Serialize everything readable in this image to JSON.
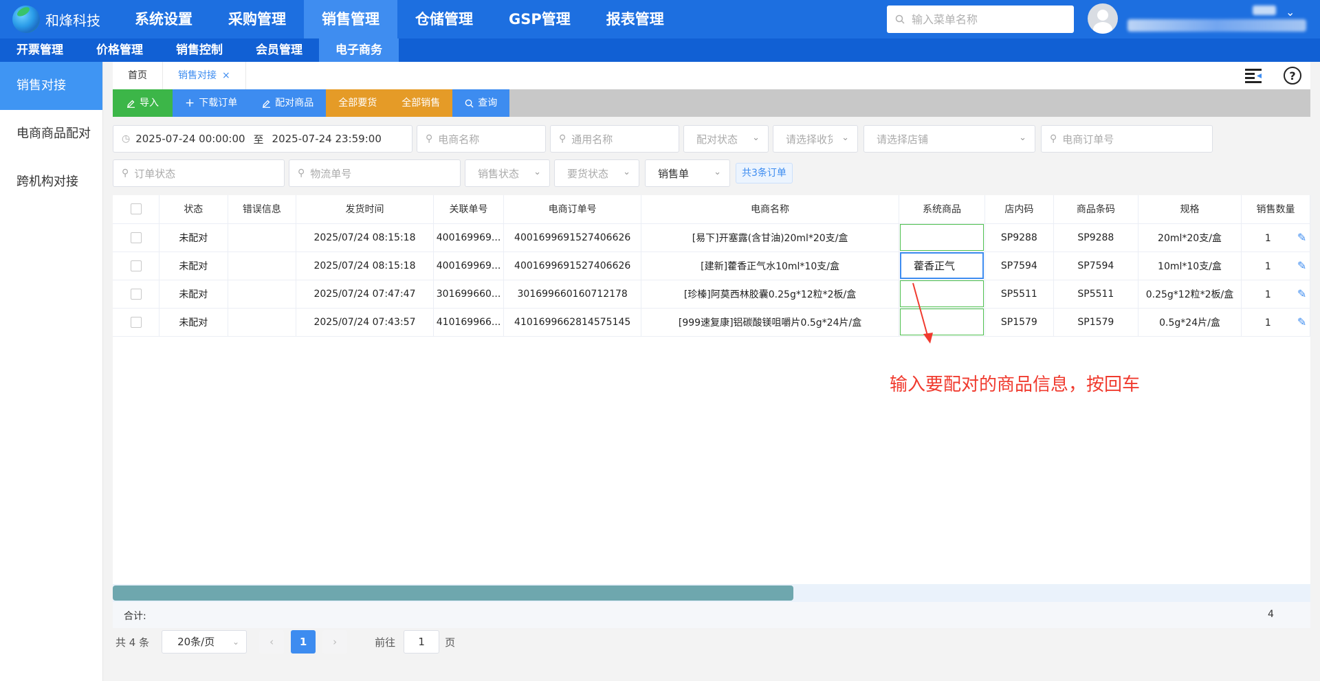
{
  "brand": {
    "name": "和烽科技"
  },
  "topnav": [
    {
      "label": "系统设置",
      "active": false
    },
    {
      "label": "采购管理",
      "active": false
    },
    {
      "label": "销售管理",
      "active": true
    },
    {
      "label": "仓储管理",
      "active": false
    },
    {
      "label": "GSP管理",
      "active": false
    },
    {
      "label": "报表管理",
      "active": false
    }
  ],
  "search": {
    "placeholder": "输入菜单名称"
  },
  "subnav": [
    {
      "label": "开票管理",
      "active": false
    },
    {
      "label": "价格管理",
      "active": false
    },
    {
      "label": "销售控制",
      "active": false
    },
    {
      "label": "会员管理",
      "active": false
    },
    {
      "label": "电子商务",
      "active": true
    }
  ],
  "sidebar": [
    {
      "label": "销售对接",
      "active": true
    },
    {
      "label": "电商商品配对",
      "active": false
    },
    {
      "label": "跨机构对接",
      "active": false
    }
  ],
  "tabs": [
    {
      "label": "首页",
      "active": false
    },
    {
      "label": "销售对接",
      "active": true,
      "close": "×"
    }
  ],
  "toolbar": [
    {
      "label": "导入",
      "icon": "edit-icon",
      "color": "green"
    },
    {
      "label": "下载订单",
      "icon": "plus-icon",
      "color": "blue"
    },
    {
      "label": "配对商品",
      "icon": "edit-icon",
      "color": "blue"
    },
    {
      "label": "全部要货",
      "icon": "",
      "color": "orange"
    },
    {
      "label": "全部销售",
      "icon": "",
      "color": "orange"
    },
    {
      "label": "查询",
      "icon": "search-icon",
      "color": "blue"
    }
  ],
  "filters": {
    "date_start": "2025-07-24 00:00:00",
    "date_sep": "至",
    "date_end": "2025-07-24 23:59:00",
    "ecommerce_name": "电商名称",
    "generic_name": "通用名称",
    "pair_status": "配对状态",
    "receiver": "请选择收货",
    "store": "请选择店铺",
    "ecommerce_order_no": "电商订单号",
    "order_status": "订单状态",
    "logistics_no": "物流单号",
    "sales_status": "销售状态",
    "request_status": "要货状态",
    "doc_type": "销售单",
    "order_count": "共3条订单"
  },
  "table": {
    "columns": [
      "",
      "状态",
      "错误信息",
      "发货时间",
      "关联单号",
      "电商订单号",
      "电商名称",
      "系统商品",
      "店内码",
      "商品条码",
      "规格",
      "销售数量"
    ],
    "rows": [
      {
        "status": "未配对",
        "error": "",
        "ship_time": "2025/07/24 08:15:18",
        "ref_no": "400169969...",
        "order_no": "4001699691527406626",
        "name": "[易下]开塞露(含甘油)20ml*20支/盒",
        "sys_product": "",
        "store_code": "SP9288",
        "barcode": "SP9288",
        "spec": "20ml*20支/盒",
        "qty": "1"
      },
      {
        "status": "未配对",
        "error": "",
        "ship_time": "2025/07/24 08:15:18",
        "ref_no": "400169969...",
        "order_no": "4001699691527406626",
        "name": "[建新]藿香正气水10ml*10支/盒",
        "sys_product": "藿香正气",
        "store_code": "SP7594",
        "barcode": "SP7594",
        "spec": "10ml*10支/盒",
        "qty": "1"
      },
      {
        "status": "未配对",
        "error": "",
        "ship_time": "2025/07/24 07:47:47",
        "ref_no": "301699660...",
        "order_no": "301699660160712178",
        "name": "[珍榛]阿莫西林胶囊0.25g*12粒*2板/盒",
        "sys_product": "",
        "store_code": "SP5511",
        "barcode": "SP5511",
        "spec": "0.25g*12粒*2板/盒",
        "qty": "1"
      },
      {
        "status": "未配对",
        "error": "",
        "ship_time": "2025/07/24 07:43:57",
        "ref_no": "410169966...",
        "order_no": "4101699662814575145",
        "name": "[999速复康]铝碳酸镁咀嚼片0.5g*24片/盒",
        "sys_product": "",
        "store_code": "SP1579",
        "barcode": "SP1579",
        "spec": "0.5g*24片/盒",
        "qty": "1"
      }
    ],
    "summary_label": "合计:",
    "summary_qty": "4"
  },
  "annotation": "输入要配对的商品信息，按回车",
  "pager": {
    "total": "共 4 条",
    "page_size": "20条/页",
    "current": "1",
    "goto_label": "前往",
    "goto_value": "1",
    "goto_unit": "页"
  },
  "colors": {
    "primary": "#1d6fe0",
    "accent": "#3d8cf0",
    "green": "#3cb648",
    "orange": "#e59b27",
    "annotation": "#f03a2e"
  }
}
